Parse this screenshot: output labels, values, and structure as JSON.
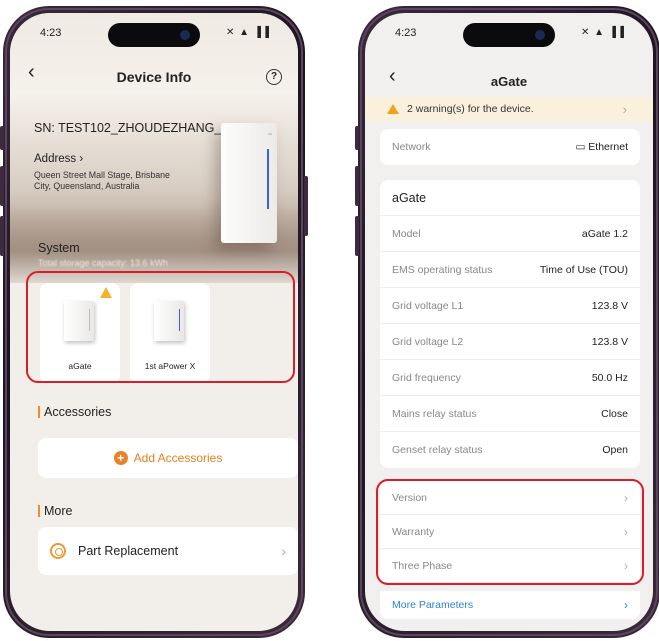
{
  "left": {
    "status": {
      "time": "4:23",
      "icons": "✕ ▲ ▐▐"
    },
    "header": {
      "title": "Device Info",
      "help_icon": "?"
    },
    "serial": "SN: TEST102_ZHOUDEZHANG_1120",
    "address_label": "Address",
    "address_value": "Queen Street Mall Stage, Brisbane City, Queensland, Australia",
    "system_title": "System",
    "capacity_text": "Total storage capacity: 13.6 kWh",
    "devices": [
      {
        "label": "aGate",
        "warning": true
      },
      {
        "label": "1st aPower X",
        "warning": false
      }
    ],
    "accessories": {
      "title": "Accessories",
      "add_label": "Add Accessories"
    },
    "more": {
      "title": "More",
      "items": [
        {
          "label": "Part Replacement"
        }
      ]
    }
  },
  "right": {
    "status": {
      "time": "4:23",
      "icons": "✕ ▲ ▐▐"
    },
    "header": {
      "title": "aGate"
    },
    "warning": "2 warning(s) for the device.",
    "network": {
      "label": "Network",
      "value": "Ethernet"
    },
    "agate": {
      "title": "aGate",
      "rows": [
        {
          "label": "Model",
          "value": "aGate 1.2"
        },
        {
          "label": "EMS operating status",
          "value": "Time of Use (TOU)"
        },
        {
          "label": "Grid voltage L1",
          "value": "123.8 V"
        },
        {
          "label": "Grid voltage L2",
          "value": "123.8 V"
        },
        {
          "label": "Grid frequency",
          "value": "50.0 Hz"
        },
        {
          "label": "Mains relay status",
          "value": "Close"
        },
        {
          "label": "Genset relay status",
          "value": "Open"
        }
      ]
    },
    "links": [
      {
        "label": "Version"
      },
      {
        "label": "Warranty"
      },
      {
        "label": "Three Phase"
      }
    ],
    "more_parameters": "More Parameters"
  },
  "colors": {
    "accent": "#e57f1f",
    "highlight": "#d81e2a",
    "link": "#2f80d8",
    "warning": "#f0a21a"
  }
}
